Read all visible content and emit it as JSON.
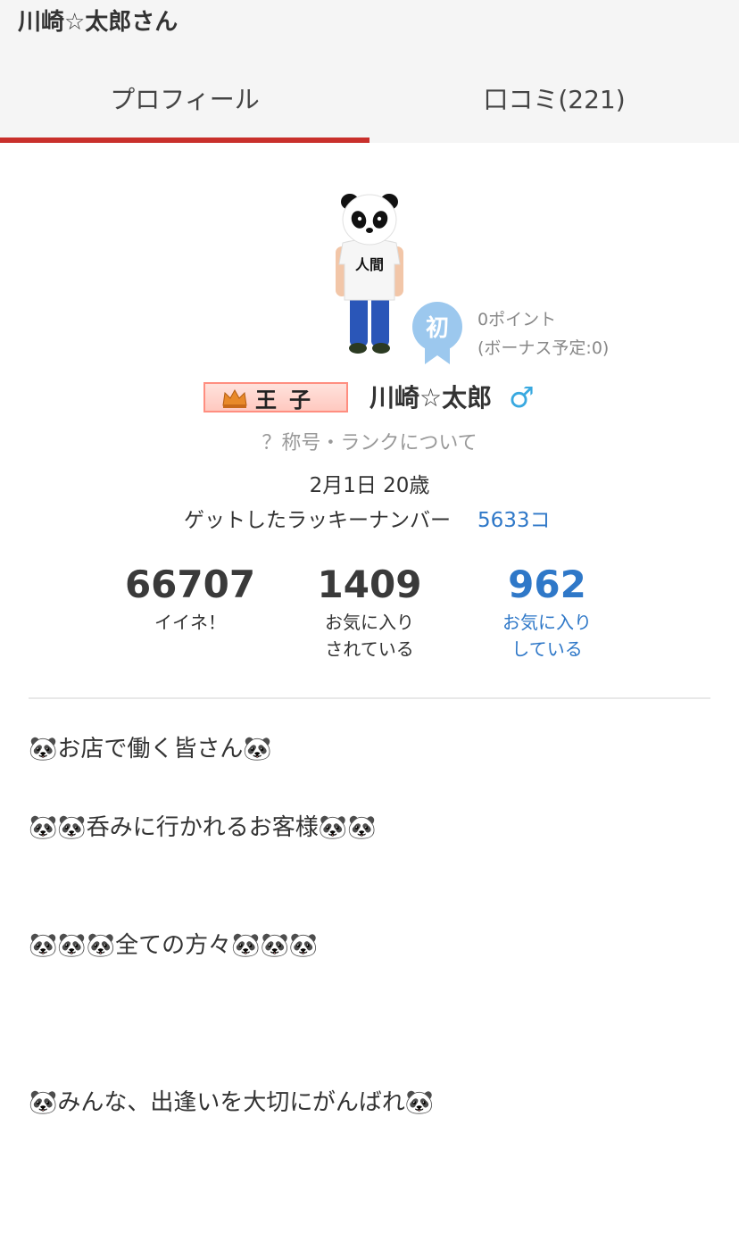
{
  "header": {
    "page_title": "川崎☆太郎さん",
    "tabs": [
      {
        "label": "プロフィール",
        "active": true
      },
      {
        "label": "口コミ(221)",
        "active": false
      }
    ],
    "active_color": "#c9302c"
  },
  "profile": {
    "rank_badge": "初",
    "points": "0ポイント",
    "bonus": "(ボーナス予定:0)",
    "title_badge": "王子",
    "username": "川崎☆太郎",
    "gender_icon": "male-symbol-icon",
    "gender_symbol": "♂",
    "rank_info_link": "？称号・ランクについて",
    "birthday": "2月1日 20歳",
    "lucky_number_label": "ゲットしたラッキーナンバー",
    "lucky_number_value": "5633コ",
    "avatar_shirt_text": "人間"
  },
  "stats": [
    {
      "value": "66707",
      "label": "イイネ！"
    },
    {
      "value": "1409",
      "label": "お気に入り\nされている"
    },
    {
      "value": "962",
      "label": "お気に入り\nしている"
    }
  ],
  "bio": [
    "🐼お店で働く皆さん🐼",
    "🐼🐼呑みに行かれるお客様🐼🐼",
    "🐼🐼🐼全ての方々🐼🐼🐼",
    "🐼みんな、出逢いを大切にがんばれ🐼"
  ],
  "colors": {
    "link": "#2f78c8",
    "muted": "#999999",
    "gender": "#39a9e0",
    "badge_blue": "#9cc8ee"
  }
}
